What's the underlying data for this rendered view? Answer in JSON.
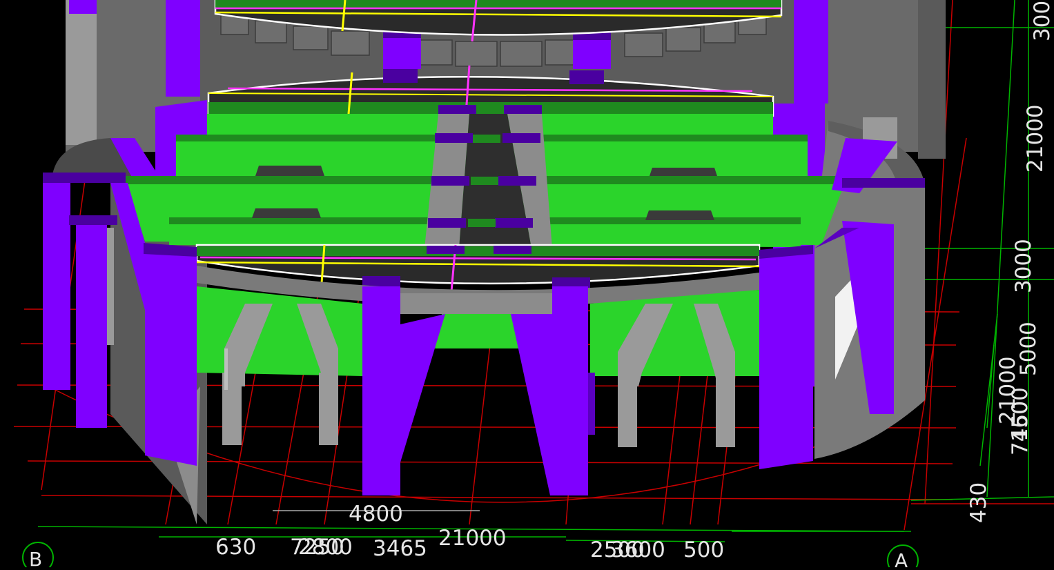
{
  "colors": {
    "background": "#000000",
    "grid_red": "#c80000",
    "grid_green": "#00b400",
    "slab_green": "#2bd42b",
    "slab_green_dark": "#1f8a1f",
    "column_purple": "#7f00ff",
    "column_purple_dark": "#4a00a0",
    "wall_grey": "#8c8c8c",
    "dark_slab": "#333333",
    "beam_yellow": "#ffff00",
    "beam_magenta": "#ff33ff",
    "outline_white": "#ffffff",
    "text": "#e6e6e6"
  },
  "axes": {
    "left_bubble": "B",
    "right_bubble": "A"
  },
  "dimensions": {
    "bottom_row1": [
      "4800"
    ],
    "bottom_row2": [
      "630",
      "7250",
      "2800",
      "3465",
      "21000",
      "2500",
      "3600",
      "500"
    ],
    "right_side": [
      "300",
      "21000",
      "3000",
      "5000",
      "21000",
      "1600",
      "7450",
      "430"
    ]
  }
}
